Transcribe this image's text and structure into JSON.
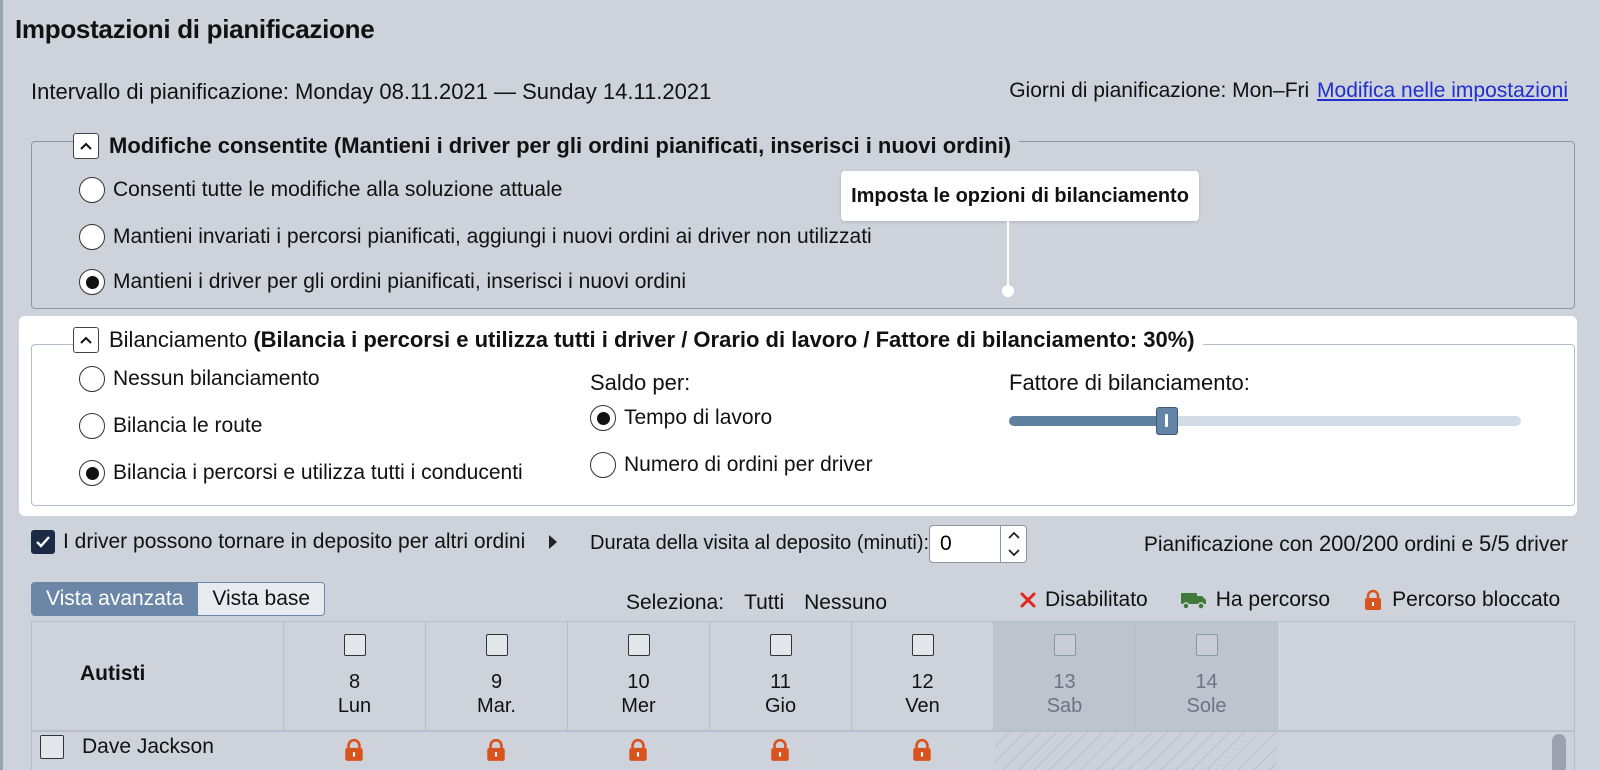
{
  "title": "Impostazioni di pianificazione",
  "range": {
    "label": "Intervallo di pianificazione:",
    "value": "Monday 08.11.2021 — Sunday 14.11.2021"
  },
  "plan_days": {
    "label": "Giorni di pianificazione: Mon–Fri",
    "link": "Modifica nelle impostazioni"
  },
  "modifications": {
    "heading": "Modifiche consentite",
    "summary": "(Mantieni i driver per gli ordini pianificati, inserisci i nuovi ordini)",
    "options": [
      {
        "label": "Consenti tutte le modifiche alla soluzione attuale",
        "checked": false
      },
      {
        "label": "Mantieni invariati i percorsi pianificati, aggiungi i nuovi ordini ai driver non utilizzati",
        "checked": false
      },
      {
        "label": "Mantieni i driver per gli ordini pianificati, inserisci i nuovi ordini",
        "checked": true
      }
    ]
  },
  "tooltip": "Imposta le opzioni di bilanciamento",
  "balancing": {
    "heading": "Bilanciamento",
    "summary": "(Bilancia i percorsi e utilizza tutti i driver / Orario di lavoro / Fattore di bilanciamento: 30%)",
    "options": [
      {
        "label": "Nessun bilanciamento",
        "checked": false
      },
      {
        "label": "Bilancia le route",
        "checked": false
      },
      {
        "label": "Bilancia i percorsi e utilizza tutti i conducenti",
        "checked": true
      }
    ],
    "balance_by_label": "Saldo per:",
    "balance_by": [
      {
        "label": "Tempo di lavoro",
        "checked": true
      },
      {
        "label": "Numero di ordini per driver",
        "checked": false
      }
    ],
    "factor_label": "Fattore di bilanciamento:",
    "factor_value": 0.3
  },
  "depot": {
    "return_label": "I driver possono tornare in deposito per altri ordini",
    "return_checked": true,
    "duration_label": "Durata della visita al deposito (minuti):",
    "duration_value": "0"
  },
  "summary": {
    "prefix": "Pianificazione con",
    "orders": "200/200",
    "mid": "ordini e",
    "drivers": "5/5",
    "suffix": "driver"
  },
  "views": {
    "advanced": "Vista avanzata",
    "basic": "Vista base"
  },
  "select": {
    "label": "Seleziona:",
    "all": "Tutti",
    "none": "Nessuno"
  },
  "legend": {
    "disabled": "Disabilitato",
    "has_route": "Ha percorso",
    "locked": "Percorso bloccato"
  },
  "colors": {
    "accent": "#6b86a6",
    "lock": "#d9531e",
    "truck": "#3f7a3a",
    "disabled": "#e0261f"
  },
  "grid": {
    "drivers_header": "Autisti",
    "days": [
      {
        "num": "8",
        "name": "Lun",
        "weekend": false
      },
      {
        "num": "9",
        "name": "Mar.",
        "weekend": false
      },
      {
        "num": "10",
        "name": "Mer",
        "weekend": false
      },
      {
        "num": "11",
        "name": "Gio",
        "weekend": false
      },
      {
        "num": "12",
        "name": "Ven",
        "weekend": false
      },
      {
        "num": "13",
        "name": "Sab",
        "weekend": true
      },
      {
        "num": "14",
        "name": "Sole",
        "weekend": true
      }
    ],
    "rows": [
      {
        "name": "Dave Jackson"
      }
    ]
  }
}
